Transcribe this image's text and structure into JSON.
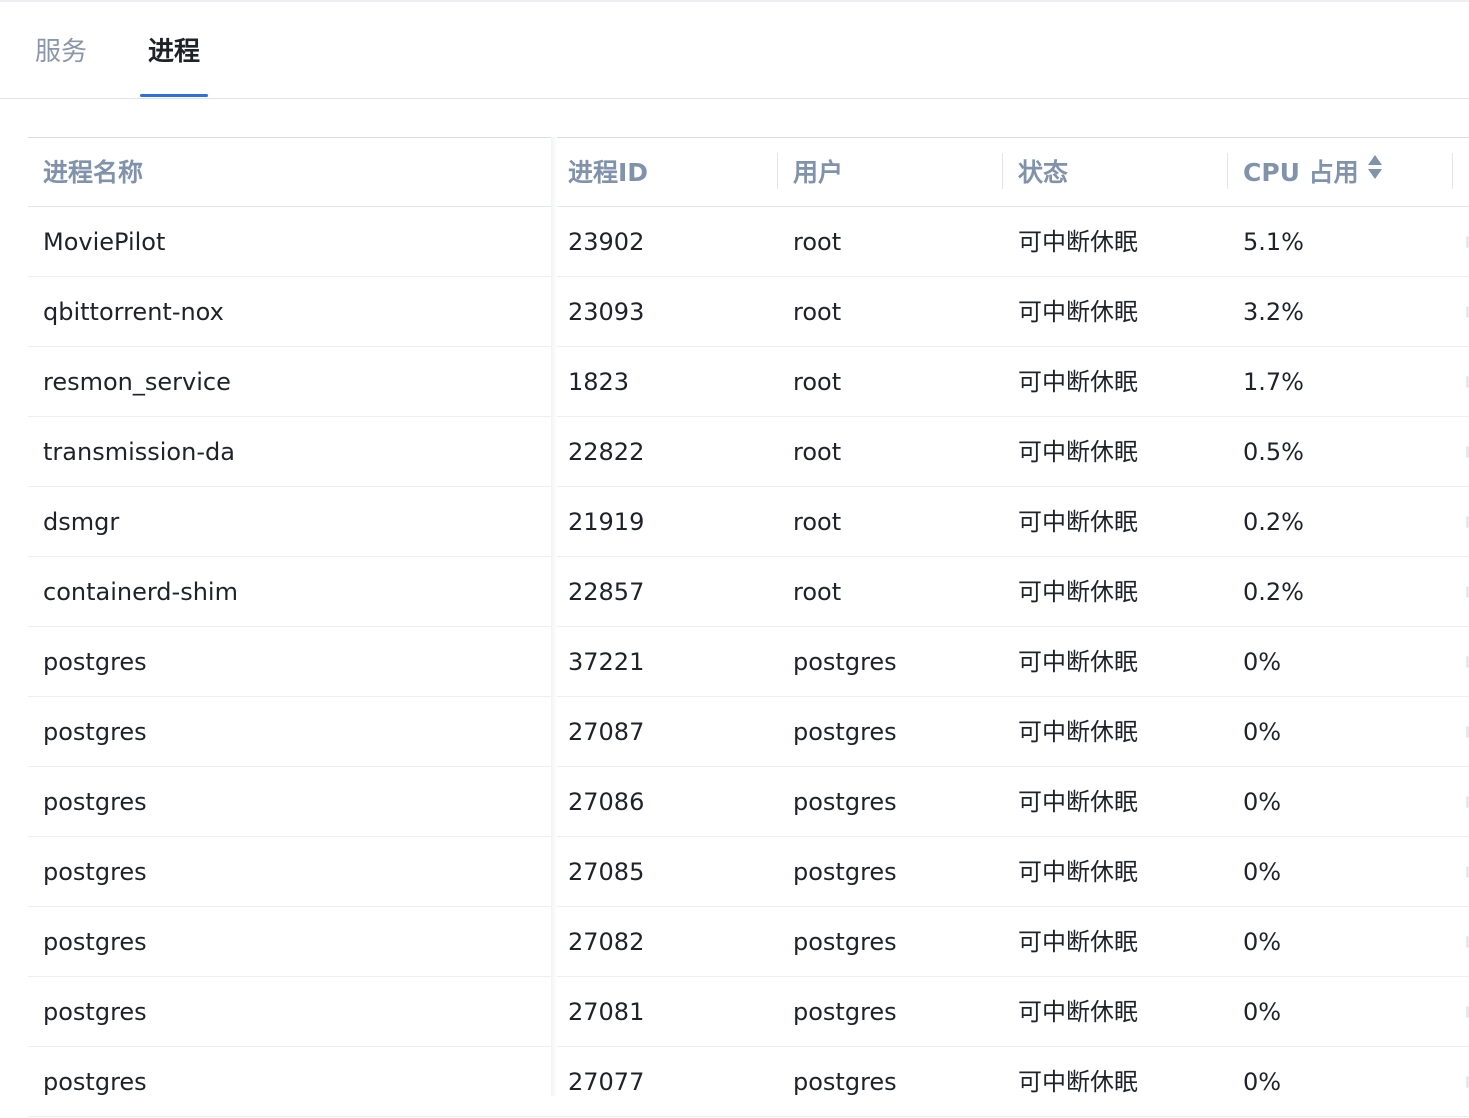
{
  "tabs": [
    {
      "label": "服务",
      "active": false
    },
    {
      "label": "进程",
      "active": true
    }
  ],
  "table": {
    "columns": [
      "进程名称",
      "进程ID",
      "用户",
      "状态",
      "CPU 占用"
    ],
    "sort_column": "CPU 占用",
    "rows": [
      {
        "name": "MoviePilot",
        "pid": "23902",
        "user": "root",
        "status": "可中断休眠",
        "cpu": "5.1%"
      },
      {
        "name": "qbittorrent-nox",
        "pid": "23093",
        "user": "root",
        "status": "可中断休眠",
        "cpu": "3.2%"
      },
      {
        "name": "resmon_service",
        "pid": "1823",
        "user": "root",
        "status": "可中断休眠",
        "cpu": "1.7%"
      },
      {
        "name": "transmission-da",
        "pid": "22822",
        "user": "root",
        "status": "可中断休眠",
        "cpu": "0.5%"
      },
      {
        "name": "dsmgr",
        "pid": "21919",
        "user": "root",
        "status": "可中断休眠",
        "cpu": "0.2%"
      },
      {
        "name": "containerd-shim",
        "pid": "22857",
        "user": "root",
        "status": "可中断休眠",
        "cpu": "0.2%"
      },
      {
        "name": "postgres",
        "pid": "37221",
        "user": "postgres",
        "status": "可中断休眠",
        "cpu": "0%"
      },
      {
        "name": "postgres",
        "pid": "27087",
        "user": "postgres",
        "status": "可中断休眠",
        "cpu": "0%"
      },
      {
        "name": "postgres",
        "pid": "27086",
        "user": "postgres",
        "status": "可中断休眠",
        "cpu": "0%"
      },
      {
        "name": "postgres",
        "pid": "27085",
        "user": "postgres",
        "status": "可中断休眠",
        "cpu": "0%"
      },
      {
        "name": "postgres",
        "pid": "27082",
        "user": "postgres",
        "status": "可中断休眠",
        "cpu": "0%"
      },
      {
        "name": "postgres",
        "pid": "27081",
        "user": "postgres",
        "status": "可中断休眠",
        "cpu": "0%"
      },
      {
        "name": "postgres",
        "pid": "27077",
        "user": "postgres",
        "status": "可中断休眠",
        "cpu": "0%"
      }
    ]
  },
  "colors": {
    "accent": "#2f6fe0",
    "header_text": "#8193ab",
    "tab_inactive": "#8a97a8",
    "text": "#1f2329"
  }
}
